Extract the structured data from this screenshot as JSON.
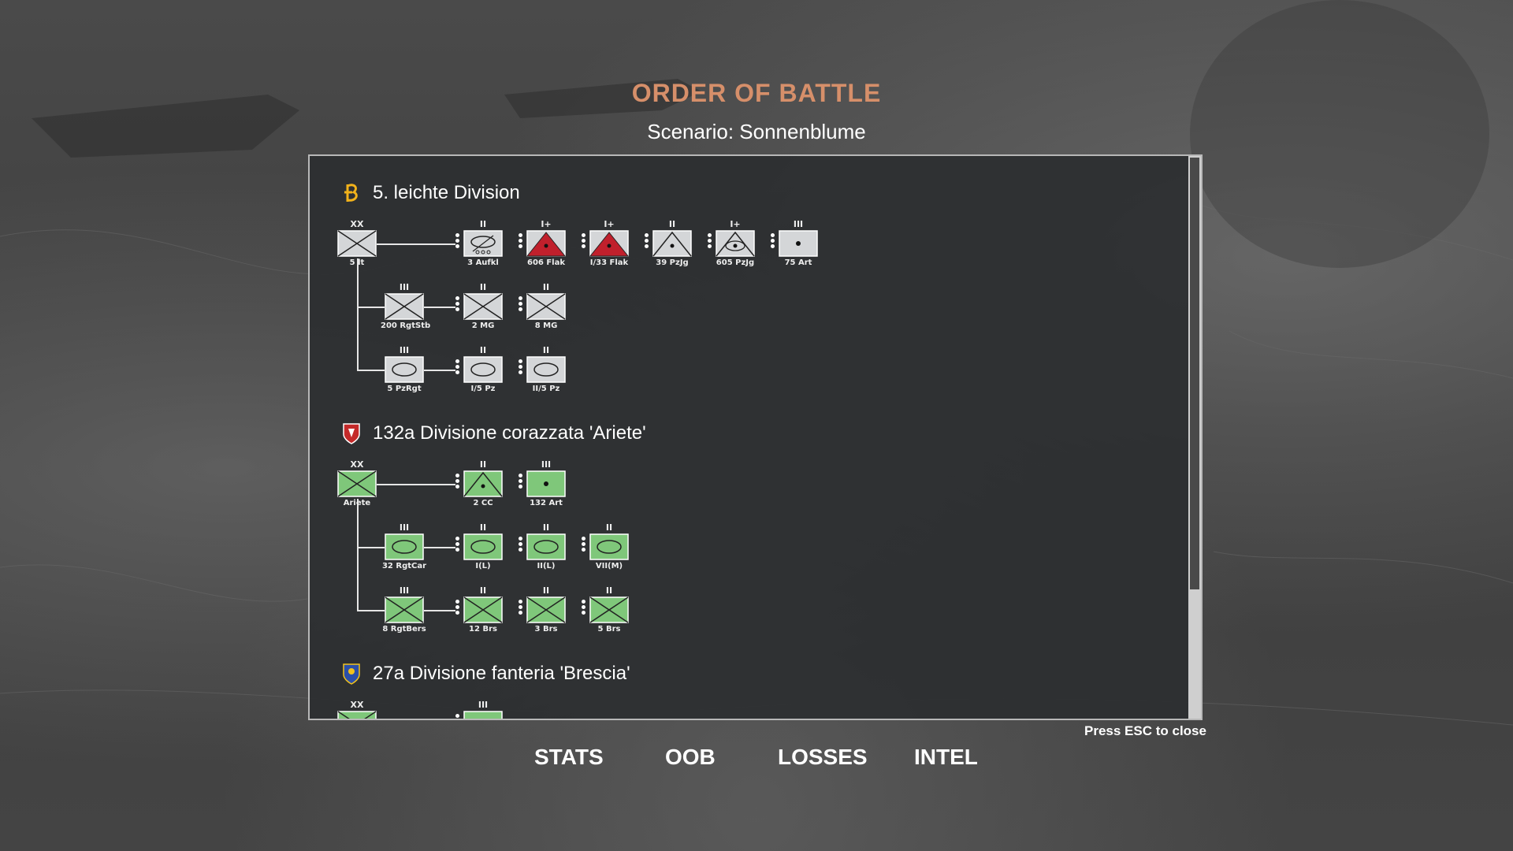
{
  "header": {
    "title": "ORDER OF BATTLE",
    "subtitle": "Scenario: Sonnenblume"
  },
  "colors": {
    "title": "#d68f6a",
    "german_counter": "#d4d6d8",
    "italian_counter": "#7fc77a",
    "flak_red": "#c0202c"
  },
  "divisions": [
    {
      "name": "5. leichte Division",
      "emblem": "afrika-korps-palm-icon",
      "units": [
        {
          "size": "XX",
          "label": "5 lt",
          "type": "infantry"
        },
        {
          "size": "II",
          "label": "3 Aufkl",
          "type": "recon-armor"
        },
        {
          "size": "I+",
          "label": "606 Flak",
          "type": "flak"
        },
        {
          "size": "I+",
          "label": "I/33 Flak",
          "type": "flak"
        },
        {
          "size": "II",
          "label": "39 PzJg",
          "type": "antitank"
        },
        {
          "size": "I+",
          "label": "605 PzJg",
          "type": "antitank-armor"
        },
        {
          "size": "III",
          "label": "75 Art",
          "type": "artillery"
        },
        {
          "size": "III",
          "label": "200 RgtStb",
          "type": "infantry"
        },
        {
          "size": "II",
          "label": "2 MG",
          "type": "infantry"
        },
        {
          "size": "II",
          "label": "8 MG",
          "type": "infantry"
        },
        {
          "size": "III",
          "label": "5 PzRgt",
          "type": "armor"
        },
        {
          "size": "II",
          "label": "I/5 Pz",
          "type": "armor"
        },
        {
          "size": "II",
          "label": "II/5 Pz",
          "type": "armor"
        }
      ]
    },
    {
      "name": "132a Divisione corazzata 'Ariete'",
      "emblem": "ariete-crest-icon",
      "units": [
        {
          "size": "XX",
          "label": "Ariete",
          "type": "infantry"
        },
        {
          "size": "II",
          "label": "2 CC",
          "type": "antitank"
        },
        {
          "size": "III",
          "label": "132 Art",
          "type": "artillery"
        },
        {
          "size": "III",
          "label": "32 RgtCar",
          "type": "armor"
        },
        {
          "size": "II",
          "label": "I(L)",
          "type": "armor"
        },
        {
          "size": "II",
          "label": "II(L)",
          "type": "armor"
        },
        {
          "size": "II",
          "label": "VII(M)",
          "type": "armor"
        },
        {
          "size": "III",
          "label": "8 RgtBers",
          "type": "infantry"
        },
        {
          "size": "II",
          "label": "12 Brs",
          "type": "infantry"
        },
        {
          "size": "II",
          "label": "3 Brs",
          "type": "infantry"
        },
        {
          "size": "II",
          "label": "5 Brs",
          "type": "infantry"
        }
      ]
    },
    {
      "name": "27a Divisione fanteria 'Brescia'",
      "emblem": "brescia-crest-icon",
      "units": [
        {
          "size": "XX",
          "label": "",
          "type": "infantry"
        },
        {
          "size": "III",
          "label": "",
          "type": "artillery"
        }
      ]
    }
  ],
  "footer": {
    "esc_hint": "Press ESC to close",
    "tabs": [
      "STATS",
      "OOB",
      "LOSSES",
      "INTEL"
    ]
  }
}
